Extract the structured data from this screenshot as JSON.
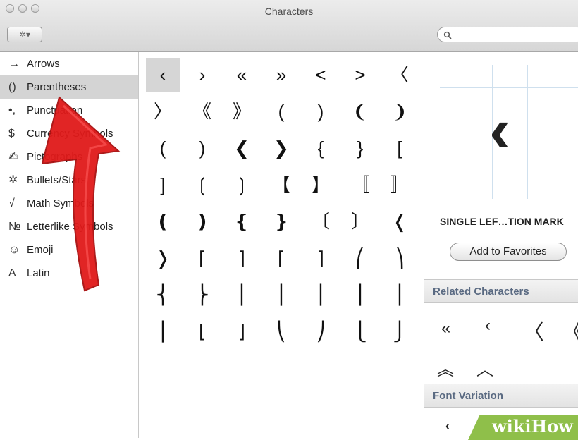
{
  "window": {
    "title": "Characters"
  },
  "toolbar": {
    "gear_label": "✲▾",
    "search_placeholder": ""
  },
  "sidebar": {
    "items": [
      {
        "icon": "→",
        "label": "Arrows"
      },
      {
        "icon": "()",
        "label": "Parentheses"
      },
      {
        "icon": "•,",
        "label": "Punctuation"
      },
      {
        "icon": "$",
        "label": "Currency Symbols"
      },
      {
        "icon": "✍",
        "label": "Pictographs"
      },
      {
        "icon": "✲",
        "label": "Bullets/Stars"
      },
      {
        "icon": "√",
        "label": "Math Symbols"
      },
      {
        "icon": "№",
        "label": "Letterlike Symbols"
      },
      {
        "icon": "☺",
        "label": "Emoji"
      },
      {
        "icon": "A",
        "label": "Latin"
      }
    ],
    "selected": "Parentheses"
  },
  "grid": {
    "rows": [
      [
        "‹",
        "›",
        "«",
        "»",
        "<",
        ">",
        "〈"
      ],
      [
        "〉",
        "《",
        "》",
        "(",
        ")",
        "❨",
        "❩"
      ],
      [
        "(",
        ")",
        "❮",
        "❯",
        "{",
        "}",
        "["
      ],
      [
        "]",
        "❲",
        "❳",
        "【",
        "】",
        "〚",
        "〛"
      ],
      [
        "❪",
        "❫",
        "❴",
        "❵",
        "〔",
        "〕",
        "❬"
      ],
      [
        "❭",
        "⌈",
        "⌉",
        "⌈",
        "⌉",
        "⎛",
        "⎞"
      ],
      [
        "⎨",
        "⎬",
        "⎪",
        "⎪",
        "⎪",
        "⎪",
        "⎪"
      ],
      [
        "⎪",
        "⌊",
        "⌋",
        "⎝",
        "⎠",
        "⎩",
        "⎭"
      ]
    ],
    "selected": "‹"
  },
  "details": {
    "preview_glyph": "‹",
    "char_name": "SINGLE LEF…TION MARK",
    "favorites_label": "Add to Favorites",
    "related_header": "Related Characters",
    "related": [
      "«",
      "‹",
      "〈",
      "《",
      "︽",
      "︿"
    ],
    "font_variation_header": "Font Variation",
    "variation_glyph": "‹"
  },
  "watermark": {
    "text_a": "wiki",
    "text_b": "How"
  },
  "colors": {
    "selection": "#d4d4d4",
    "section_header": "#5a6a82",
    "arrow": "#e01a1a"
  }
}
